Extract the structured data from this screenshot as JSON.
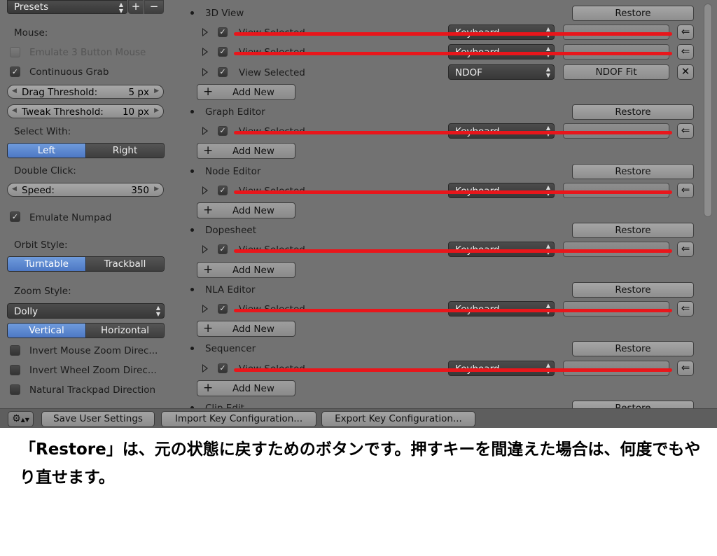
{
  "left_panel": {
    "presets_label": "Presets",
    "mouse_heading": "Mouse:",
    "emulate_3_button": "Emulate 3 Button Mouse",
    "continuous_grab": "Continuous Grab",
    "drag_threshold": {
      "label": "Drag Threshold:",
      "value": "5 px"
    },
    "tweak_threshold": {
      "label": "Tweak Threshold:",
      "value": "10 px"
    },
    "select_with": {
      "label": "Select With:",
      "options": [
        "Left",
        "Right"
      ],
      "active": "Left"
    },
    "double_click": {
      "label": "Double Click:",
      "speed_label": "Speed:",
      "speed_value": "350"
    },
    "emulate_numpad": "Emulate Numpad",
    "orbit_style": {
      "label": "Orbit Style:",
      "options": [
        "Turntable",
        "Trackball"
      ],
      "active": "Turntable"
    },
    "zoom_style": {
      "label": "Zoom Style:",
      "value": "Dolly",
      "options": [
        "Vertical",
        "Horizontal"
      ],
      "active": "Vertical"
    },
    "invert_mouse_zoom": "Invert Mouse Zoom Direc...",
    "invert_wheel_zoom": "Invert Wheel Zoom Direc...",
    "natural_trackpad": "Natural Trackpad Direction"
  },
  "keymap": {
    "restore_label": "Restore",
    "add_new_label": "Add New",
    "sections": [
      {
        "name": "3D View",
        "rows": [
          {
            "action": "View Selected",
            "type": "Keyboard",
            "key": ".",
            "end_icon": "back-arrow-icon"
          },
          {
            "action": "View Selected",
            "type": "Keyboard",
            "key": ".",
            "end_icon": "back-arrow-icon"
          },
          {
            "action": "View Selected",
            "type": "NDOF",
            "key": "NDOF Fit",
            "end_icon": "close-icon"
          }
        ]
      },
      {
        "name": "Graph Editor",
        "rows": [
          {
            "action": "View Selected",
            "type": "Keyboard",
            "key": ".",
            "end_icon": "back-arrow-icon"
          }
        ]
      },
      {
        "name": "Node Editor",
        "rows": [
          {
            "action": "View Selected",
            "type": "Keyboard",
            "key": ".",
            "end_icon": "back-arrow-icon"
          }
        ]
      },
      {
        "name": "Dopesheet",
        "rows": [
          {
            "action": "View Selected",
            "type": "Keyboard",
            "key": ".",
            "end_icon": "back-arrow-icon"
          }
        ]
      },
      {
        "name": "NLA Editor",
        "rows": [
          {
            "action": "View Selected",
            "type": "Keyboard",
            "key": ".",
            "end_icon": "back-arrow-icon"
          }
        ]
      },
      {
        "name": "Sequencer",
        "rows": [
          {
            "action": "View Selected",
            "type": "Keyboard",
            "key": ".",
            "end_icon": "back-arrow-icon"
          }
        ]
      },
      {
        "name": "Clip Edit",
        "rows": []
      }
    ]
  },
  "bottom_bar": {
    "save": "Save User Settings",
    "import": "Import Key Configuration...",
    "export": "Export Key Configuration..."
  },
  "caption": "「Restore」は、元の状態に戻すためのボタンです。押すキーを間違えた場合は、何度でもやり直せます。",
  "colors": {
    "panel_bg": "#727272",
    "accent_blue": "#5a86d0",
    "annotation_red": "#e8161b"
  }
}
